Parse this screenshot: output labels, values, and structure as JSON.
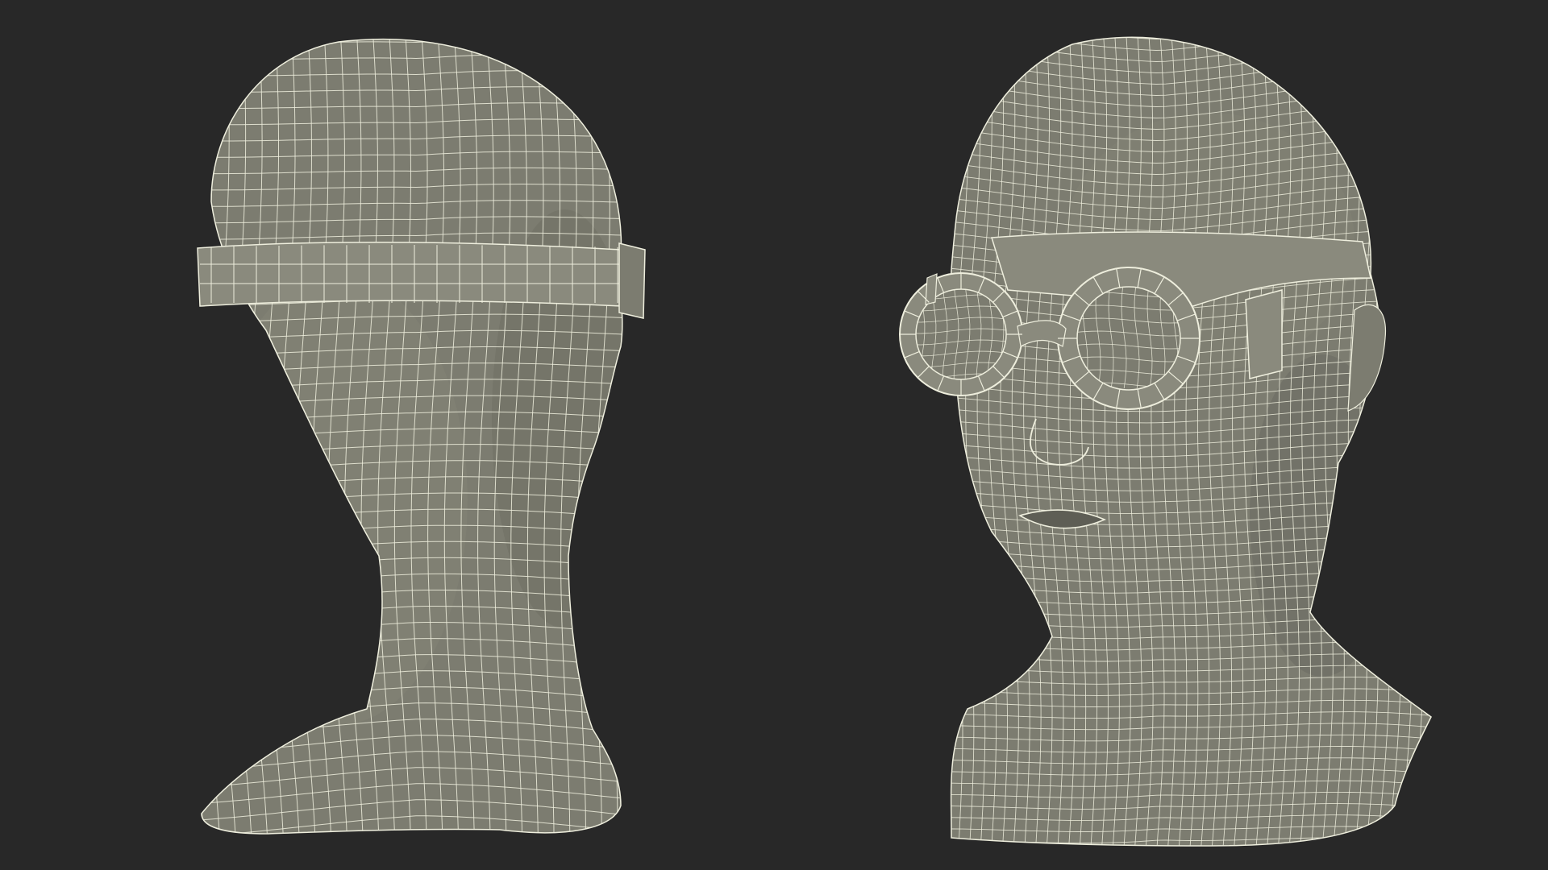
{
  "scene": {
    "background": "#282828",
    "mesh_fill": "#7c7c70",
    "mesh_fill_light": "#8a8a7d",
    "wire_color": "#eeeedd",
    "shadow_color": "#5e5e55"
  },
  "views": [
    {
      "name": "back-view",
      "subject": "head-with-goggles"
    },
    {
      "name": "front-three-quarter-view",
      "subject": "head-with-goggles"
    }
  ]
}
